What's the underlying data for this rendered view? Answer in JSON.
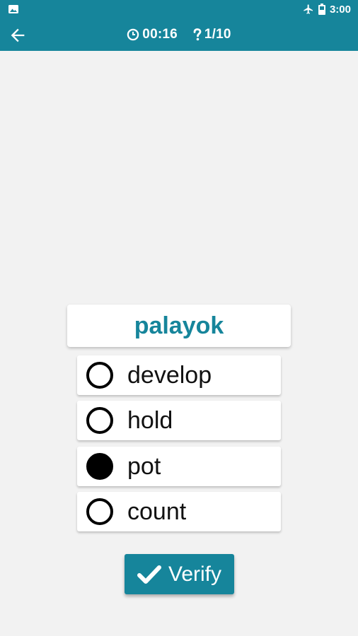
{
  "status_bar": {
    "time": "3:00",
    "icons": [
      "gallery-icon",
      "airplane-icon",
      "battery-icon"
    ]
  },
  "app_bar": {
    "back_icon": "arrow-left-icon",
    "timer_icon": "clock-icon",
    "timer": "00:16",
    "progress_icon": "question-mark-icon",
    "progress": "1/10"
  },
  "quiz": {
    "word": "palayok",
    "options": [
      {
        "label": "develop",
        "selected": false
      },
      {
        "label": "hold",
        "selected": false
      },
      {
        "label": "pot",
        "selected": true
      },
      {
        "label": "count",
        "selected": false
      }
    ],
    "verify_label": "Verify",
    "verify_icon": "checkmark-icon"
  },
  "colors": {
    "accent": "#16859b",
    "background": "#f2f2f2"
  }
}
